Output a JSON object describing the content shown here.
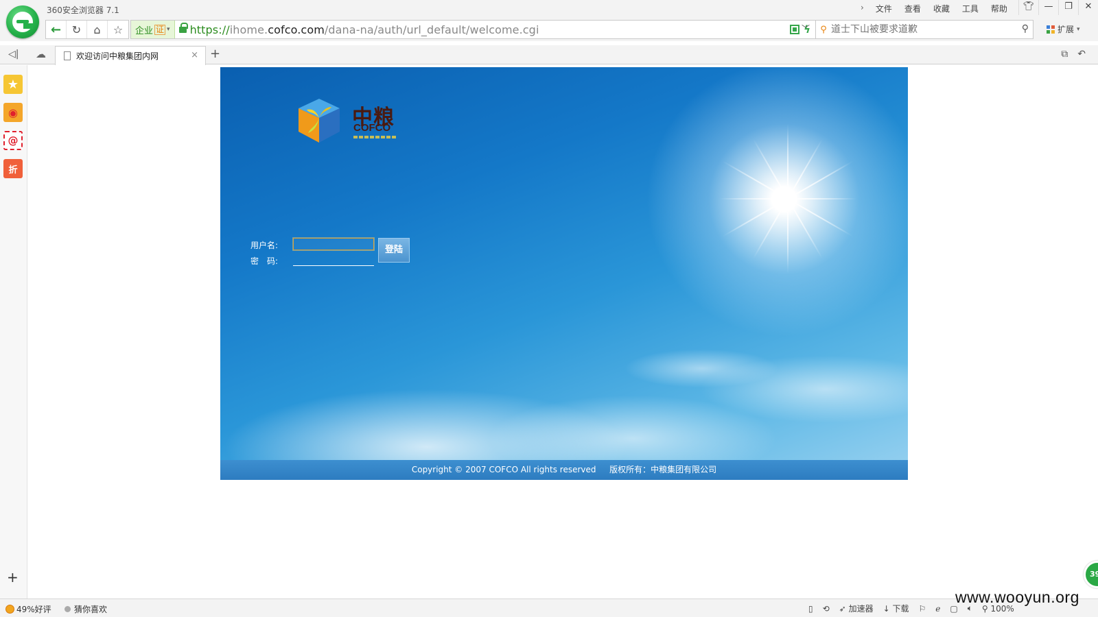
{
  "browser": {
    "title": "360安全浏览器 7.1",
    "menu": [
      "文件",
      "查看",
      "收藏",
      "工具",
      "帮助"
    ],
    "window_controls": [
      "shirt-icon",
      "minimize-icon",
      "restore-icon",
      "close-icon"
    ]
  },
  "nav": {
    "cert_label": "企业",
    "cert_badge": "证",
    "url_scheme": "https://",
    "url_sub": "ihome.",
    "url_host": "cofco.com",
    "url_path": "/dana-na/auth/url_default/welcome.cgi",
    "search_placeholder": "道士下山被要求道歉",
    "extensions_label": "扩展"
  },
  "tabs": [
    {
      "title": "欢迎访问中粮集团内网",
      "active": true
    }
  ],
  "page": {
    "logo_cn": "中粮",
    "logo_en": "COFCO",
    "username_label": "用户名:",
    "password_label": "密　码:",
    "username_value": "",
    "password_value": "",
    "login_button": "登陆",
    "footer": "Copyright © 2007 COFCO All rights reserved 　 版权所有：中粮集团有限公司"
  },
  "bubble": "39",
  "status": {
    "rating": "49%好评",
    "guess": "猜你喜欢",
    "accelerator": "加速器",
    "download": "下载",
    "zoom": "100%"
  },
  "watermark": "www.wooyun.org",
  "colors": {
    "accent_green": "#2b9a3b",
    "sky_top": "#0a5fb0",
    "sky_bottom": "#9ad2f0",
    "footer_bar": "#2d7cc0",
    "logo_text": "#4a1a10"
  }
}
